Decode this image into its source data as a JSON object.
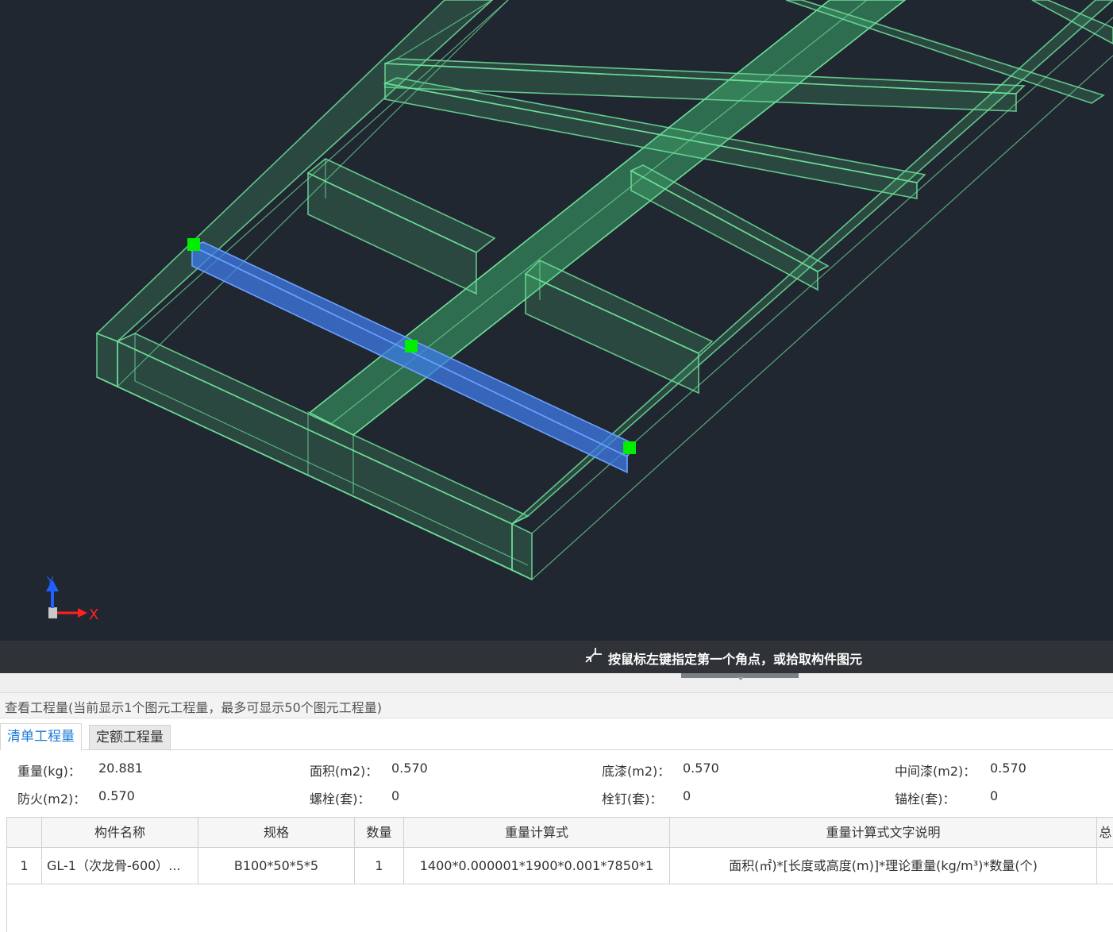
{
  "viewport": {
    "axis_y_label": "Y",
    "axis_x_label": "X",
    "colors": {
      "background": "#212730",
      "frame": "#5fd48a",
      "selected": "#3d7be8",
      "grip": "#00ee00"
    }
  },
  "statusbar": {
    "prompt": "按鼠标左键指定第一个角点，或拾取构件图元",
    "icon": "corner-select-icon"
  },
  "panel": {
    "title": "查看工程量(当前显示1个图元工程量，最多可显示50个图元工程量)",
    "tabs": [
      {
        "label": "清单工程量",
        "active": true
      },
      {
        "label": "定额工程量",
        "active": false
      }
    ],
    "summary": {
      "weight_label": "重量(kg)：",
      "weight_value": "20.881",
      "area_label": "面积(m2)：",
      "area_value": "0.570",
      "primer_label": "底漆(m2)：",
      "primer_value": "0.570",
      "middle_paint_label": "中间漆(m2)：",
      "middle_paint_value": "0.570",
      "fireproof_label": "防火(m2)：",
      "fireproof_value": "0.570",
      "bolt_label": "螺栓(套)：",
      "bolt_value": "0",
      "stud_label": "栓钉(套)：",
      "stud_value": "0",
      "anchor_label": "锚栓(套)：",
      "anchor_value": "0"
    },
    "table": {
      "columns": [
        "",
        "构件名称",
        "规格",
        "数量",
        "重量计算式",
        "重量计算式文字说明",
        "总"
      ],
      "rows": [
        [
          "1",
          "GL-1（次龙骨-600）...",
          "B100*50*5*5",
          "1",
          "1400*0.000001*1900*0.001*7850*1",
          "面积(㎡)*[长度或高度(m)]*理论重量(kg/m³)*数量(个)",
          ""
        ]
      ]
    }
  }
}
